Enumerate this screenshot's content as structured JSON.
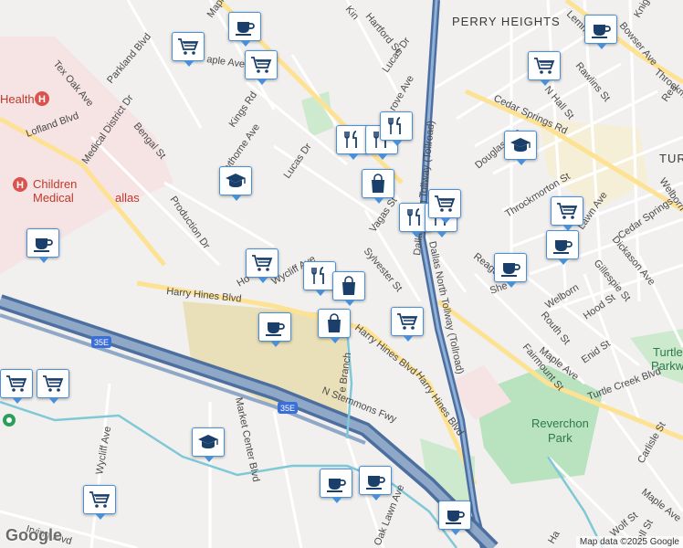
{
  "map": {
    "areas": {
      "perry_heights": "PERRY HEIGHTS",
      "turtle": "TURTL"
    },
    "parks": {
      "reverchon": [
        "Reverchon",
        "Park"
      ],
      "turtle_creek": [
        "Turtle",
        "Parkwa"
      ]
    },
    "hospitals": {
      "health": "Health",
      "childrens_1": "Children",
      "childrens_2": "Medical",
      "childrens_3": "allas"
    },
    "highway_shields": [
      "35E",
      "35E"
    ],
    "streets": {
      "harry_hines_1": "Harry Hines Blvd",
      "harry_hines_2": "Harry Hines Blvd",
      "harry_hines_3": "Harry Hines Blvd",
      "stemmons": "N Stemmons Fwy",
      "tollway_1": "Dallas North Tollway (Tollroad)",
      "tollway_2": "Dallas North Tollway (Tollroad)",
      "maple_1": "Maple Ave",
      "maple_2": "Maple Ave",
      "maple_3": "Maple Ave",
      "maple_4": "aple Ave",
      "cedar_springs_1": "Cedar Springs Rd",
      "cedar_springs_2": "Cedar Springs",
      "medical_district": "Medical District Dr",
      "parkland": "Parkland Blvd",
      "tex_oak": "Tex Oak Ave",
      "lofland": "Lofland Blvd",
      "bengal": "Bengal St",
      "kings": "Kings Rd",
      "hawthorne": "wthorne Ave",
      "lucas_1": "Lucas Dr",
      "lucas_2": "Lucas Dr",
      "production": "Production Dr",
      "wycliff_1": "Wycliff Ave",
      "wycliff_2": "Wycliff Ave",
      "vagas": "Vagas St",
      "sylvester": "Sylvester St",
      "hartford": "Hartford St",
      "grove": "rove Ave",
      "douglas": "Douglas Ave",
      "throckmorton_1": "Throckmorton St",
      "throckmorton_2": "Throckmo",
      "lemmon": "Lemm",
      "bowser": "Bowser Ave",
      "knight": "Knight St",
      "rawlins": "Rawlins St",
      "hall": "N Hall St",
      "lawn": "Lawn Ave",
      "dickason": "Dickason Ave",
      "gillespie": "Gillespie St",
      "welborn_1": "Welborn St",
      "welborn_2": "Welborn",
      "reagan": "Reagan",
      "she": "She",
      "routh": "Routh St",
      "hood": "Hood St",
      "fairmount": "Fairmount St",
      "enid": "Enid St",
      "turtle_creek": "Turtle Creek Blvd",
      "carlisle": "Carlisle St",
      "wolf": "Wolf St",
      "randall": "dall St",
      "market_center": "Market Center Blvd",
      "oak_lawn": "Oak Lawn Ave",
      "irving": "Irving Blvd",
      "branch": "e Branch",
      "ho": "Ho",
      "kin": "Kin",
      "reag_top": "Rea",
      "ha": "Ha"
    },
    "attribution": "Map data ©2025 Google",
    "logo": "Google"
  },
  "pois": [
    {
      "type": "coffee"
    },
    {
      "type": "grocery"
    },
    {
      "type": "grocery"
    },
    {
      "type": "coffee"
    },
    {
      "type": "grocery"
    },
    {
      "type": "school"
    },
    {
      "type": "restaurant"
    },
    {
      "type": "restaurant"
    },
    {
      "type": "restaurant"
    },
    {
      "type": "shopping"
    },
    {
      "type": "school"
    },
    {
      "type": "coffee"
    },
    {
      "type": "grocery"
    },
    {
      "type": "restaurant"
    },
    {
      "type": "restaurant"
    },
    {
      "type": "grocery"
    },
    {
      "type": "coffee"
    },
    {
      "type": "coffee"
    },
    {
      "type": "grocery"
    },
    {
      "type": "restaurant"
    },
    {
      "type": "shopping"
    },
    {
      "type": "shopping"
    },
    {
      "type": "coffee"
    },
    {
      "type": "grocery"
    },
    {
      "type": "grocery"
    },
    {
      "type": "grocery"
    },
    {
      "type": "school"
    },
    {
      "type": "coffee"
    },
    {
      "type": "coffee"
    },
    {
      "type": "grocery"
    },
    {
      "type": "coffee"
    }
  ]
}
